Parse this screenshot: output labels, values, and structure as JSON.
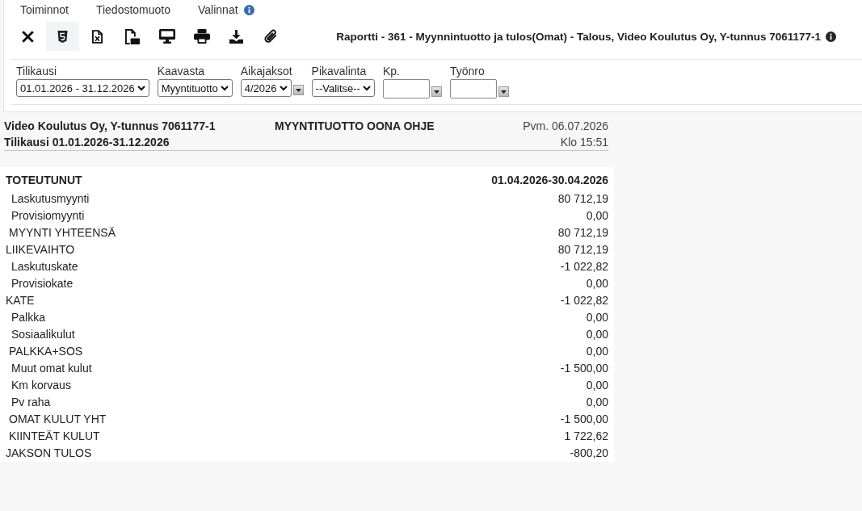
{
  "menu": [
    {
      "label": "Toiminnot",
      "info": false
    },
    {
      "label": "Tiedostomuoto",
      "info": false
    },
    {
      "label": "Valinnat",
      "info": true
    }
  ],
  "toolbar": [
    {
      "kind": "close",
      "selected": false
    },
    {
      "kind": "html",
      "selected": true
    },
    {
      "kind": "excel",
      "selected": false
    },
    {
      "kind": "pdf",
      "selected": false
    },
    {
      "kind": "screen",
      "selected": false
    },
    {
      "kind": "print",
      "selected": false
    },
    {
      "kind": "download",
      "selected": false
    },
    {
      "kind": "attach",
      "selected": false
    }
  ],
  "report_title": "Raportti - 361 - Myynnintuotto ja tulos(Omat) - Talous, Video Koulutus Oy, Y-tunnus 7061177-1",
  "filters": [
    {
      "label": "Tilikausi",
      "kind": "select",
      "value": "01.01.2026 - 31.12.2026",
      "picker": false
    },
    {
      "label": "Kaavasta",
      "kind": "select",
      "value": "Myyntituotto",
      "picker": false
    },
    {
      "label": "Aikajaksot",
      "kind": "select",
      "value": "4/2026",
      "picker": true
    },
    {
      "label": "Pikavalinta",
      "kind": "select",
      "value": "--Valitse--",
      "picker": false
    },
    {
      "label": "Kp.",
      "kind": "input",
      "picker": true
    },
    {
      "label": "Työnro",
      "kind": "input",
      "picker": true
    }
  ],
  "report": {
    "company": "Video Koulutus Oy, Y-tunnus 7061177-1",
    "heading": "MYYNTITUOTTO OONA OHJE",
    "date": "Pvm. 06.07.2026",
    "period": "Tilikausi 01.01.2026-31.12.2026",
    "time": "Klo 15:51",
    "table": {
      "section": "TOTEUTUNUT",
      "column": "01.04.2026-30.04.2026",
      "rows": [
        {
          "label": "Laskutusmyynti",
          "value": "80 712,19",
          "kind": "item"
        },
        {
          "label": "Provisiomyynti",
          "value": "0,00",
          "kind": "item"
        },
        {
          "label": "MYYNTI YHTEENSÄ",
          "value": "80 712,19",
          "kind": "subtotal"
        },
        {
          "label": "LIIKEVAIHTO",
          "value": "80 712,19",
          "kind": "total"
        },
        {
          "label": "Laskutuskate",
          "value": "-1 022,82",
          "kind": "item"
        },
        {
          "label": "Provisiokate",
          "value": "0,00",
          "kind": "item"
        },
        {
          "label": "KATE",
          "value": "-1 022,82",
          "kind": "total"
        },
        {
          "label": "Palkka",
          "value": "0,00",
          "kind": "item"
        },
        {
          "label": "Sosiaalikulut",
          "value": "0,00",
          "kind": "item"
        },
        {
          "label": "PALKKA+SOS",
          "value": "0,00",
          "kind": "subtotal"
        },
        {
          "label": "Muut omat kulut",
          "value": "-1 500,00",
          "kind": "item"
        },
        {
          "label": "Km korvaus",
          "value": "0,00",
          "kind": "item"
        },
        {
          "label": "Pv raha",
          "value": "0,00",
          "kind": "item"
        },
        {
          "label": "OMAT KULUT YHT",
          "value": "-1 500,00",
          "kind": "subtotal"
        },
        {
          "label": "KIINTEÄT KULUT",
          "value": "1 722,62",
          "kind": "subtotal"
        },
        {
          "label": "JAKSON TULOS",
          "value": "-800,20",
          "kind": "total"
        }
      ]
    }
  }
}
